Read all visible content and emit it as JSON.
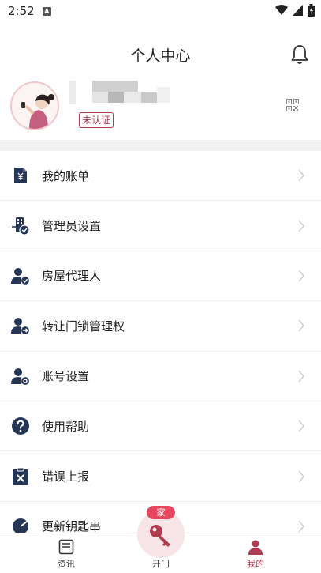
{
  "status_bar": {
    "time": "2:52",
    "notification": "A"
  },
  "header": {
    "title": "个人中心"
  },
  "profile": {
    "verify_status": "未认证"
  },
  "menu": {
    "items": [
      {
        "label": "我的账单",
        "icon": "bill-icon"
      },
      {
        "label": "管理员设置",
        "icon": "admin-settings-icon"
      },
      {
        "label": "房屋代理人",
        "icon": "agent-user-icon"
      },
      {
        "label": "转让门锁管理权",
        "icon": "transfer-user-icon"
      },
      {
        "label": "账号设置",
        "icon": "account-settings-icon"
      },
      {
        "label": "使用帮助",
        "icon": "help-icon"
      },
      {
        "label": "错误上报",
        "icon": "error-report-icon"
      },
      {
        "label": "更新钥匙串",
        "icon": "update-keychain-icon"
      }
    ]
  },
  "tabbar": {
    "news": "资讯",
    "open": "开门",
    "open_badge": "家",
    "mine": "我的"
  },
  "colors": {
    "accent": "#b03a50",
    "icon": "#243556",
    "badge": "#e8485f"
  }
}
